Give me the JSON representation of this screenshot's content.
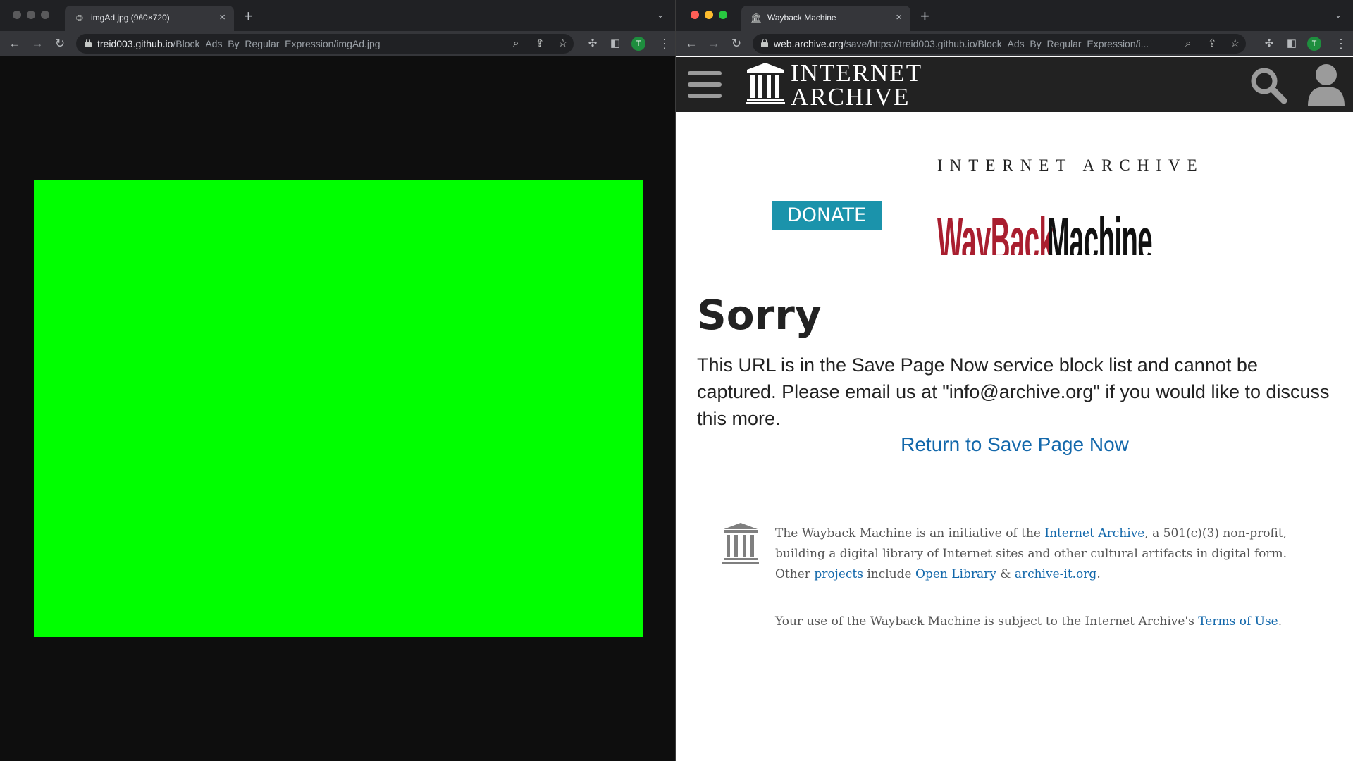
{
  "left_browser": {
    "tab_title": "imgAd.jpg (960×720)",
    "url_host": "treid003.github.io",
    "url_path": "/Block_Ads_By_Regular_Expression/imgAd.jpg",
    "profile_initial": "T",
    "image_color": "#00ff00"
  },
  "right_browser": {
    "tab_title": "Wayback Machine",
    "url_host": "web.archive.org",
    "url_path": "/save/https://treid003.github.io/Block_Ads_By_Regular_Expression/i...",
    "profile_initial": "T"
  },
  "ia_header": {
    "logo_line1": "INTERNET",
    "logo_line2": "ARCHIVE"
  },
  "wayback": {
    "donate_label": "DONATE",
    "logo_top_text": "INTERNET ARCHIVE",
    "logo_word_red": "WayBack",
    "logo_word_black": "Machine",
    "heading": "Sorry",
    "message": "This URL is in the Save Page Now service block list and cannot be captured. Please email us at \"info@archive.org\" if you would like to discuss this more.",
    "return_link": "Return to Save Page Now"
  },
  "footer": {
    "p1_part1": "The Wayback Machine is an initiative of the ",
    "p1_link_ia": "Internet Archive",
    "p1_part2": ", a 501(c)(3) non-profit, building a digital library of Internet sites and other cultural artifacts in digital form. Other ",
    "p1_link_projects": "projects",
    "p1_part3": " include ",
    "p1_link_openlib": "Open Library",
    "p1_part4": " & ",
    "p1_link_archiveit": "archive-it.org",
    "p1_part5": ".",
    "p2_part1": "Your use of the Wayback Machine is subject to the Internet Archive's ",
    "p2_link_terms": "Terms of Use",
    "p2_part2": "."
  },
  "colors": {
    "link": "#1368ab",
    "donate": "#1b93ab",
    "wayback_red": "#a91e2f",
    "header_bg": "#222222"
  }
}
